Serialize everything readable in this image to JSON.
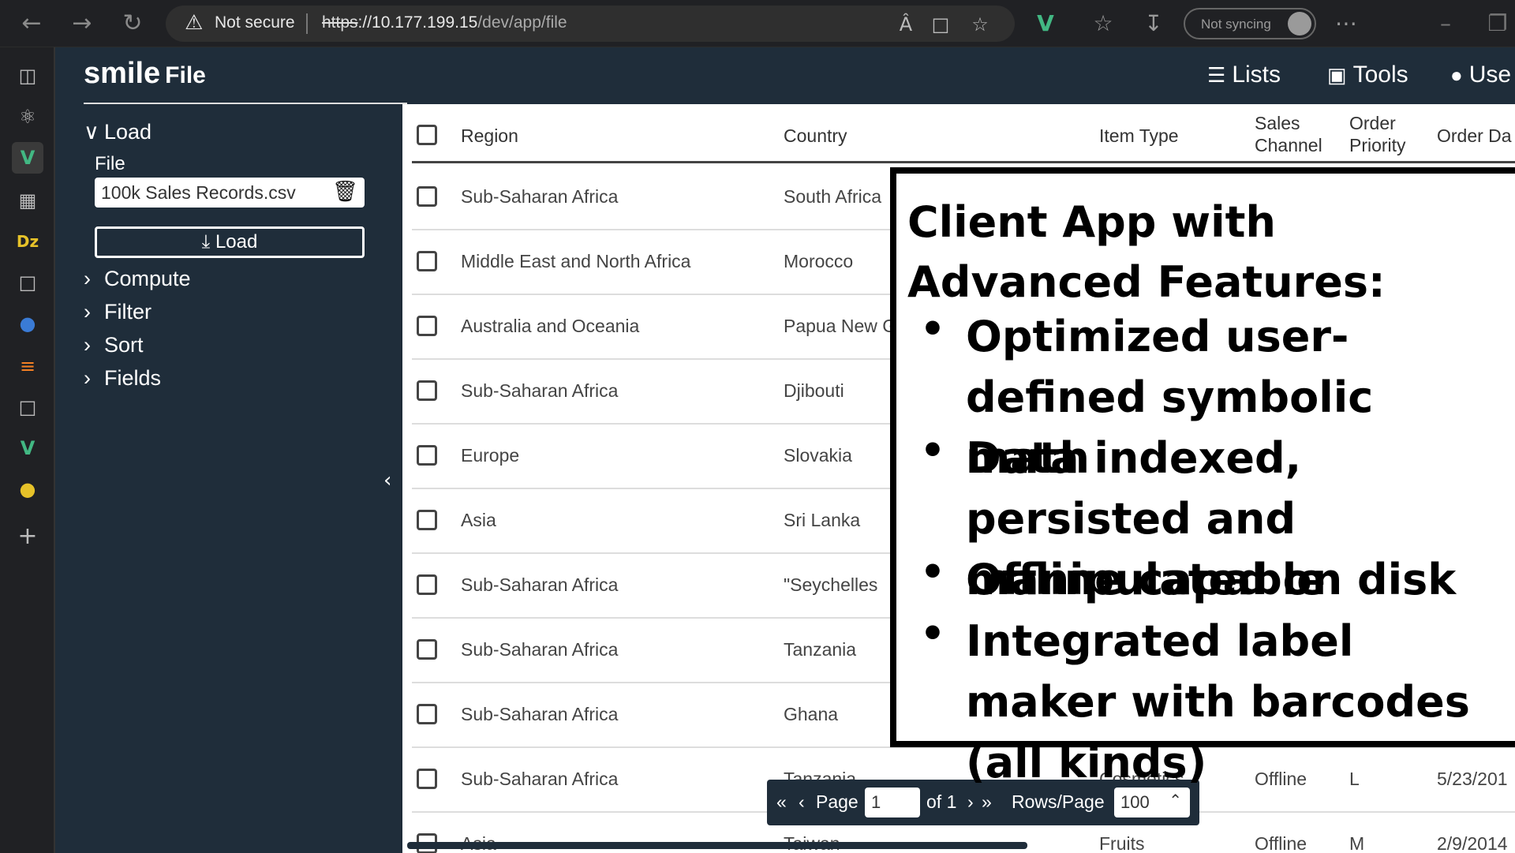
{
  "browser": {
    "security_label": "Not secure",
    "url_scheme": "https",
    "url_host": "://10.177.199.15",
    "url_path": "/dev/app/file",
    "sync_label": "Not syncing"
  },
  "app": {
    "brand": "smile",
    "page": "File",
    "nav": {
      "lists": "Lists",
      "tools": "Tools",
      "user": "Use"
    }
  },
  "left_panel": {
    "load_section": "Load",
    "file_label": "File",
    "file_name": "100k Sales Records.csv",
    "load_button": "Load",
    "sections": [
      "Compute",
      "Filter",
      "Sort",
      "Fields"
    ]
  },
  "table": {
    "headers": {
      "region": "Region",
      "country": "Country",
      "item_type": "Item Type",
      "sales_channel_1": "Sales",
      "sales_channel_2": "Channel",
      "order_priority_1": "Order",
      "order_priority_2": "Priority",
      "order_date": "Order Da"
    },
    "rows": [
      {
        "region": "Sub-Saharan Africa",
        "country": "South Africa"
      },
      {
        "region": "Middle East and North Africa",
        "country": "Morocco"
      },
      {
        "region": "Australia and Oceania",
        "country": "Papua New G"
      },
      {
        "region": "Sub-Saharan Africa",
        "country": "Djibouti"
      },
      {
        "region": "Europe",
        "country": "Slovakia"
      },
      {
        "region": "Asia",
        "country": "Sri Lanka"
      },
      {
        "region": "Sub-Saharan Africa",
        "country": "\"Seychelles"
      },
      {
        "region": "Sub-Saharan Africa",
        "country": "Tanzania"
      },
      {
        "region": "Sub-Saharan Africa",
        "country": "Ghana"
      },
      {
        "region": "Sub-Saharan Africa",
        "country": "Tanzania",
        "item_type": "Cosmetics",
        "sales_channel": "Offline",
        "order_priority": "L",
        "order_date": "5/23/201"
      },
      {
        "region": "Asia",
        "country": "Taiwan",
        "item_type": "Fruits",
        "sales_channel": "Offline",
        "order_priority": "M",
        "order_date": "2/9/2014"
      }
    ]
  },
  "pager": {
    "page_label": "Page",
    "page_value": "1",
    "of_label": "of 1",
    "rows_label": "Rows/Page",
    "rows_value": "100"
  },
  "callout": {
    "title": "Client App with Advanced Features:",
    "bullets": [
      "Optimized user-defined symbolic math",
      "Data indexed, persisted and manipulated on disk",
      "Offline capable",
      "Integrated label maker with barcodes (all kinds)"
    ]
  }
}
